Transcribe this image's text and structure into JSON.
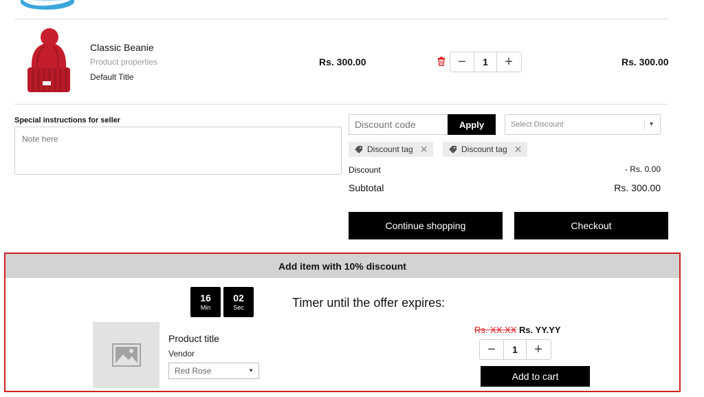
{
  "cart": {
    "item": {
      "title": "Classic Beanie",
      "properties": "Product properties",
      "variant": "Default Title",
      "price": "Rs. 300.00",
      "quantity": "1",
      "line_total": "Rs. 300.00",
      "minus": "−",
      "plus": "+"
    },
    "instructions": {
      "label": "Special instructions for seller",
      "placeholder": "Note here"
    },
    "discount": {
      "code_placeholder": "Discount code",
      "apply_label": "Apply",
      "select_label": "Select Discount",
      "tags": [
        "Discount tag",
        "Discount tag"
      ],
      "discount_label": "Discount",
      "discount_value": "- Rs. 0.00",
      "subtotal_label": "Subtotal",
      "subtotal_value": "Rs. 300.00"
    },
    "buttons": {
      "continue": "Continue shopping",
      "checkout": "Checkout"
    }
  },
  "offer": {
    "header": "Add item with 10% discount",
    "timer": {
      "minutes": "16",
      "minutes_label": "Min",
      "seconds": "02",
      "seconds_label": "Sec",
      "caption": "Timer until the offer expires:"
    },
    "product": {
      "title": "Product title",
      "vendor": "Vendor",
      "variant_selected": "Red Rose",
      "old_price": "Rs. XX.XX",
      "new_price": "Rs. YY.YY",
      "quantity": "1",
      "minus": "−",
      "plus": "+",
      "add_to_cart": "Add to cart"
    }
  },
  "colors": {
    "accent_black": "#000000",
    "offer_border": "#d21f1f",
    "strike_red": "#e02020"
  },
  "icons": [
    "shoe-image",
    "beanie-image",
    "trash-icon",
    "tag-icon",
    "close-icon",
    "chevron-down-icon",
    "image-placeholder-icon"
  ]
}
